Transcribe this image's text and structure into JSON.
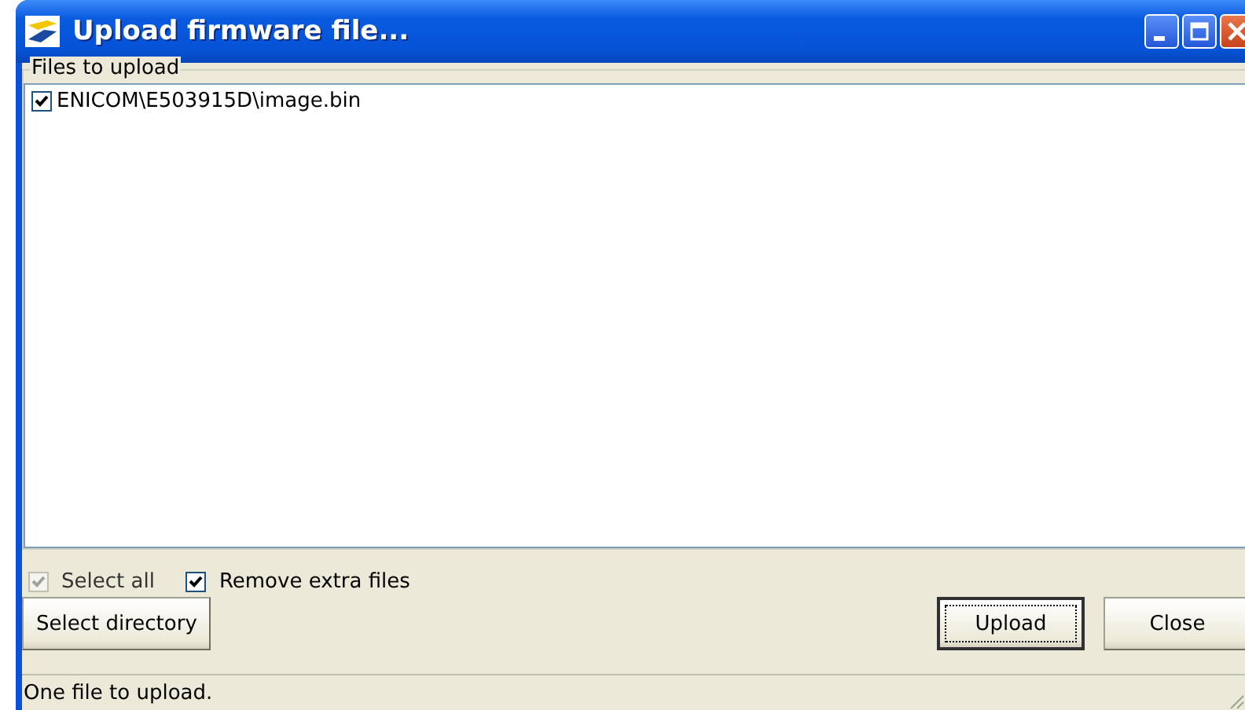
{
  "window": {
    "title": "Upload firmware file..."
  },
  "files_group": {
    "label": "Files to upload",
    "files": [
      {
        "path": "ENICOM\\E503915D\\image.bin",
        "checked": true
      }
    ]
  },
  "options": [
    {
      "label": "Select all",
      "checked": true,
      "disabled": true
    },
    {
      "label": "Remove extra files",
      "checked": true,
      "disabled": false
    }
  ],
  "buttons": [
    {
      "label": "Select directory",
      "kind": "left",
      "default": false
    },
    {
      "label": "Upload",
      "kind": "right",
      "default": true
    },
    {
      "label": "Close",
      "kind": "right",
      "default": false
    }
  ],
  "status_bar": "One file to upload."
}
